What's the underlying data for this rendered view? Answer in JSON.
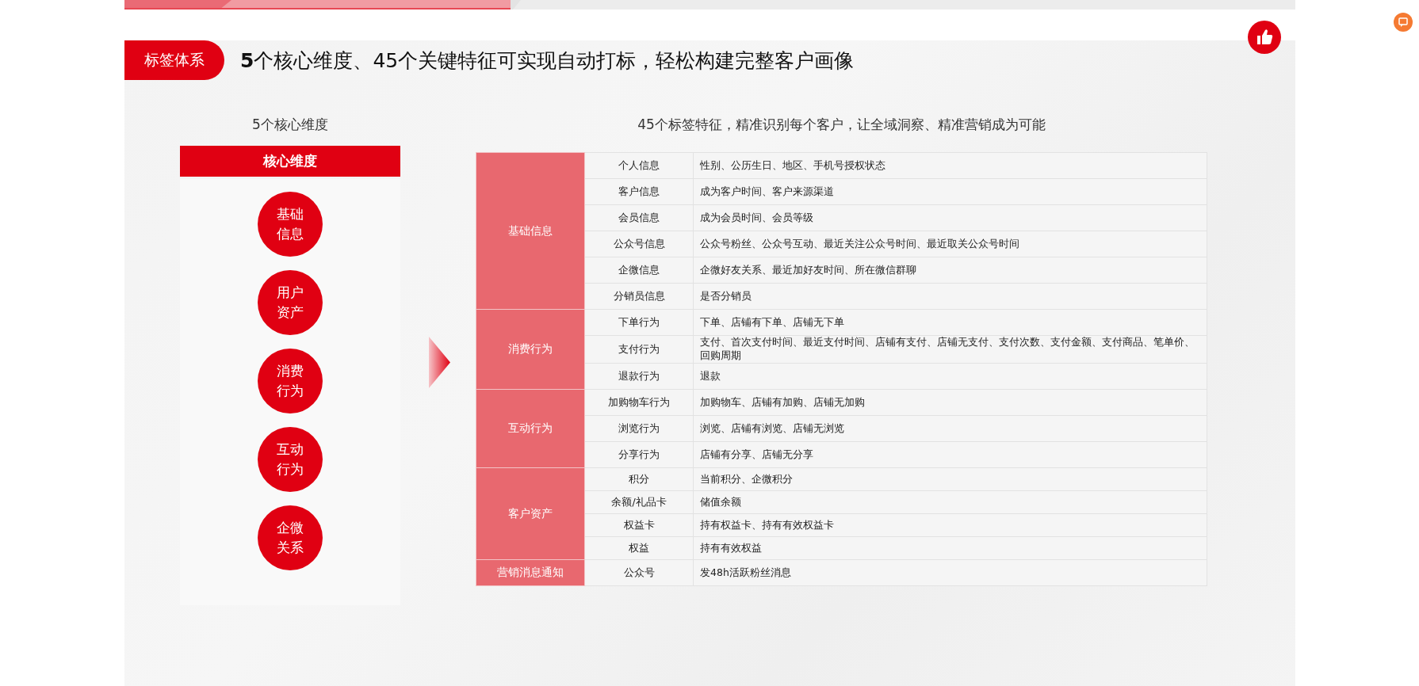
{
  "slide": {
    "tag": "标签体系",
    "headline": "**5**个核心维度、45个关键特征可实现自动打标，轻松构建完整客户画像"
  },
  "dimensions": {
    "subtitle": "5个核心维度",
    "header": "核心维度",
    "items": [
      {
        "lines": [
          "基础",
          "信息"
        ]
      },
      {
        "lines": [
          "用户",
          "资产"
        ]
      },
      {
        "lines": [
          "消费",
          "行为"
        ]
      },
      {
        "lines": [
          "互动",
          "行为"
        ]
      },
      {
        "lines": [
          "企微",
          "关系"
        ]
      }
    ]
  },
  "features": {
    "subtitle": "45个标签特征，精准识别每个客户，让全域洞察、精准营销成为可能",
    "groups": [
      {
        "category": "基础信息",
        "rows": [
          {
            "name": "个人信息",
            "detail": "性别、公历生日、地区、手机号授权状态"
          },
          {
            "name": "客户信息",
            "detail": "成为客户时间、客户来源渠道"
          },
          {
            "name": "会员信息",
            "detail": "成为会员时间、会员等级"
          },
          {
            "name": "公众号信息",
            "detail": "公众号粉丝、公众号互动、最近关注公众号时间、最近取关公众号时间"
          },
          {
            "name": "企微信息",
            "detail": "企微好友关系、最近加好友时间、所在微信群聊"
          },
          {
            "name": "分销员信息",
            "detail": "是否分销员"
          }
        ]
      },
      {
        "category": "消费行为",
        "rows": [
          {
            "name": "下单行为",
            "detail": "下单、店铺有下单、店铺无下单"
          },
          {
            "name": "支付行为",
            "detail": "支付、首次支付时间、最近支付时间、店铺有支付、店铺无支付、支付次数、支付金额、支付商品、笔单价、回购周期"
          },
          {
            "name": "退款行为",
            "detail": "退款"
          }
        ]
      },
      {
        "category": "互动行为",
        "rows": [
          {
            "name": "加购物车行为",
            "detail": "加购物车、店铺有加购、店铺无加购"
          },
          {
            "name": "浏览行为",
            "detail": "浏览、店铺有浏览、店铺无浏览"
          },
          {
            "name": "分享行为",
            "detail": "店铺有分享、店铺无分享"
          }
        ]
      },
      {
        "category": "客户资产",
        "rows": [
          {
            "name": "积分",
            "detail": "当前积分、企微积分"
          },
          {
            "name": "余额/礼品卡",
            "detail": "储值余额"
          },
          {
            "name": "权益卡",
            "detail": "持有权益卡、持有有效权益卡"
          },
          {
            "name": "权益",
            "detail": "持有有效权益"
          }
        ]
      },
      {
        "category": "营销消息通知",
        "rows": [
          {
            "name": "公众号",
            "detail": "发48h活跃粉丝消息"
          }
        ]
      }
    ]
  }
}
